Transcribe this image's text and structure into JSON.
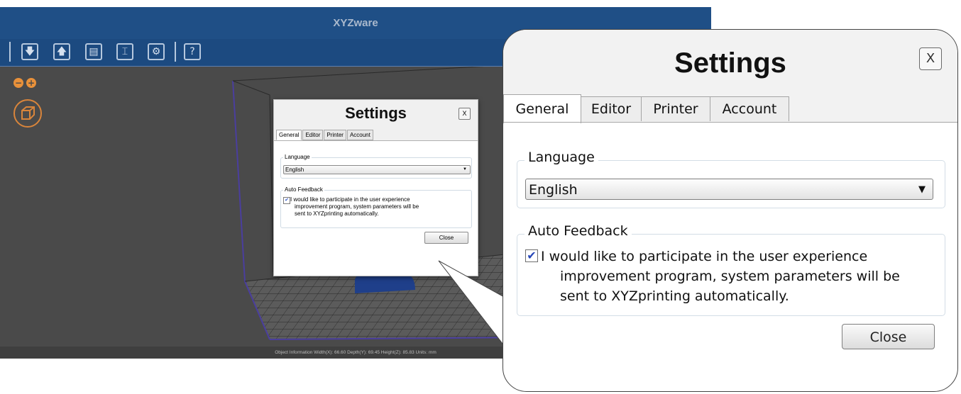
{
  "app": {
    "title": "XYZware",
    "toolbar": {
      "icons": [
        "import-icon",
        "export-icon",
        "save-icon",
        "print-icon",
        "settings-icon",
        "help-icon"
      ],
      "help_label": "?"
    },
    "zoom_out": "−",
    "zoom_in": "+",
    "status_text": "Object Information  Width(X): 66.60  Depth(Y): 69.45  Height(Z): 85.83   Units: mm"
  },
  "dialog": {
    "title": "Settings",
    "close_x": "X",
    "tabs": [
      "General",
      "Editor",
      "Printer",
      "Account"
    ],
    "active_tab": "General",
    "language": {
      "legend": "Language",
      "selected": "English"
    },
    "feedback": {
      "legend": "Auto Feedback",
      "checked": true,
      "line1": "I would like to participate in the user experience",
      "line2": "improvement program, system parameters will be",
      "line3": "sent to XYZprinting automatically."
    },
    "close_label": "Close"
  },
  "colors": {
    "titlebar": "#1f4f86",
    "accent_orange": "#e9913a",
    "checkmark": "#2747b8"
  }
}
